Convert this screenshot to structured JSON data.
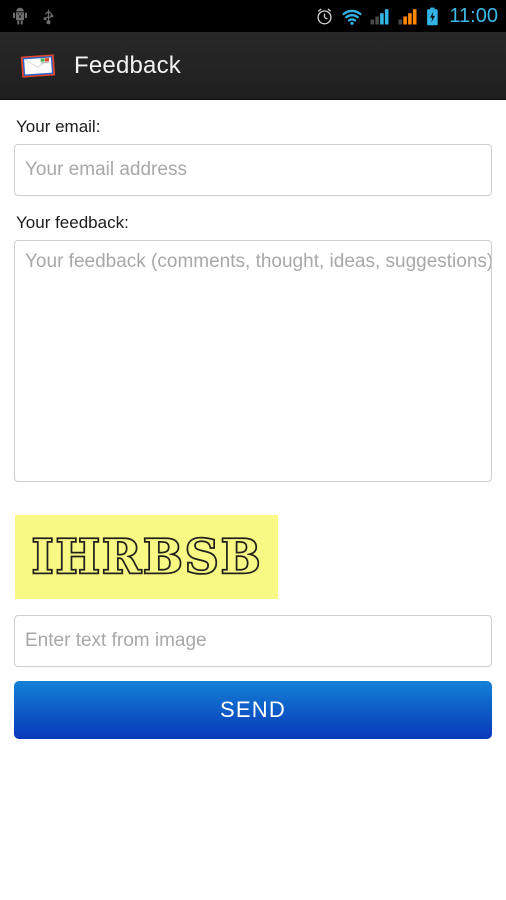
{
  "status_bar": {
    "time": "11:00",
    "icons": [
      {
        "name": "android-debug-icon"
      },
      {
        "name": "usb-icon"
      },
      {
        "name": "alarm-clock-icon"
      },
      {
        "name": "wifi-icon"
      },
      {
        "name": "signal-sim1-icon"
      },
      {
        "name": "signal-sim2-icon"
      },
      {
        "name": "battery-charging-icon"
      }
    ],
    "colors": {
      "background": "#000000",
      "clock": "#3cb8e8",
      "wifi": "#33b5e5",
      "signal1": "#33b5e5",
      "signal2": "#ff8800",
      "battery": "#33b5e5"
    }
  },
  "action_bar": {
    "title": "Feedback",
    "icon": "envelope-mail-icon",
    "background": "#242424"
  },
  "form": {
    "email": {
      "label": "Your email:",
      "placeholder": "Your email address",
      "value": ""
    },
    "feedback": {
      "label": "Your feedback:",
      "placeholder": "Your feedback (comments, thought, ideas, suggestions)",
      "value": ""
    },
    "captcha": {
      "image_text": "IHRBSB",
      "background": "#f8f884",
      "text_color": "#2b2b24",
      "input_placeholder": "Enter text from image",
      "input_value": ""
    },
    "send_button": {
      "label": "SEND",
      "color_top": "#1681d8",
      "color_bottom": "#0a38bb"
    }
  }
}
